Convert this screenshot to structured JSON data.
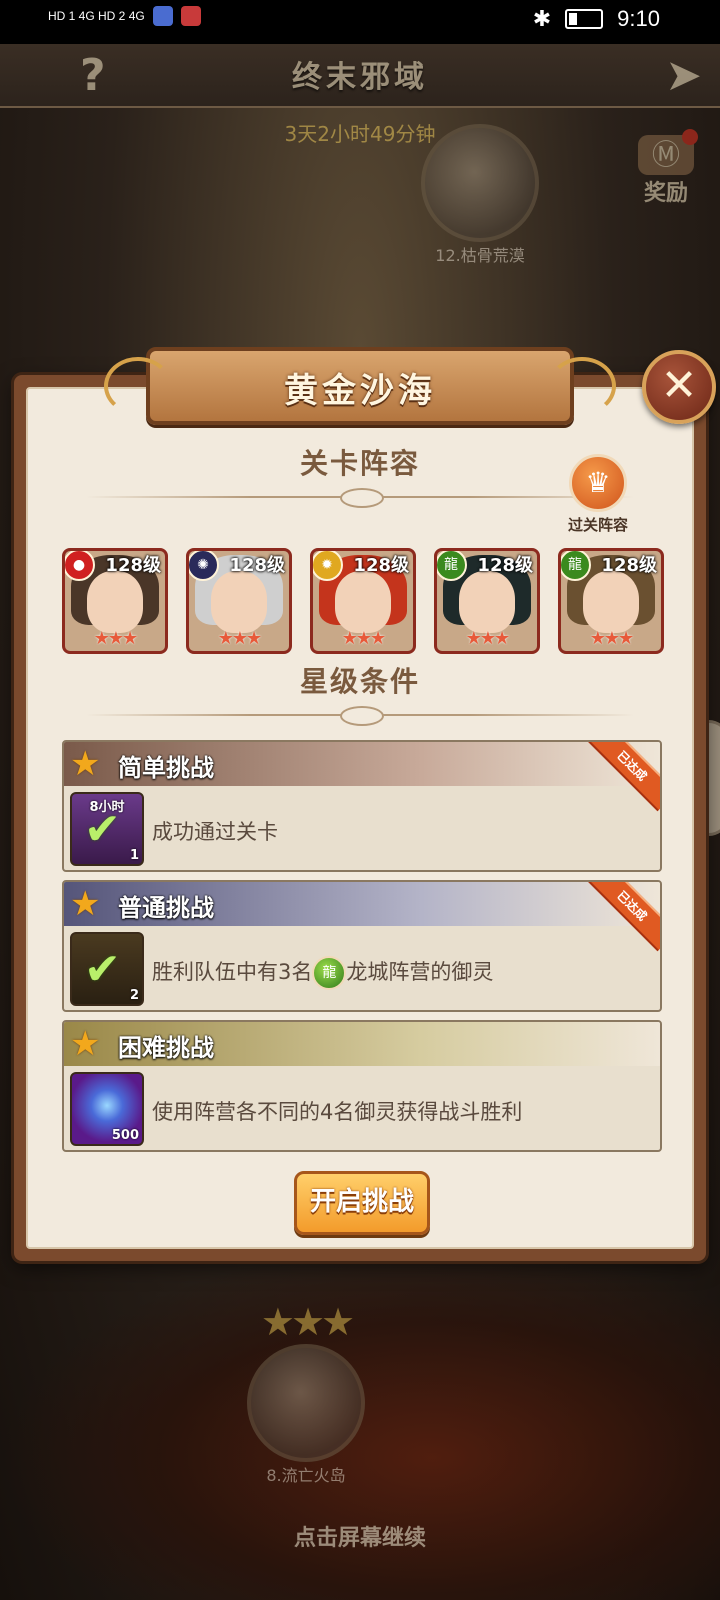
{
  "status_bar": {
    "left_text": "HD 1 4G HD 2 4G",
    "time": "9:10"
  },
  "game_header": {
    "title": "终末邪域",
    "timer": "3天2小时49分钟",
    "reward_label": "奖励",
    "help_icon": "question-mark-icon",
    "back_icon": "back-arrow-icon"
  },
  "map_nodes": [
    {
      "label": "12.枯骨荒漠"
    },
    {
      "label": "8.流亡火岛",
      "stars": "★★★"
    }
  ],
  "dialog": {
    "title": "黄金沙海",
    "lineup_title": "关卡阵容",
    "pass_lineup_label": "过关阵容",
    "star_conditions_title": "星级条件",
    "start_button": "开启挑战"
  },
  "heroes": [
    {
      "level": "128级",
      "faction": "fire",
      "faction_color": "#d02020",
      "hair_color": "#4a3628",
      "stars": "★★★"
    },
    {
      "level": "128级",
      "faction": "dark",
      "faction_color": "#2a2a5a",
      "hair_color": "#cfcfcf",
      "stars": "★★★"
    },
    {
      "level": "128级",
      "faction": "gold",
      "faction_color": "#e0a820",
      "hair_color": "#c4341c",
      "stars": "★★★"
    },
    {
      "level": "128级",
      "faction": "dragon",
      "faction_color": "#3b8a1e",
      "hair_color": "#1e2a2a",
      "stars": "★★★"
    },
    {
      "level": "128级",
      "faction": "dragon",
      "faction_color": "#3b8a1e",
      "hair_color": "#6a5030",
      "stars": "★★★"
    }
  ],
  "challenges": [
    {
      "title": "简单挑战",
      "desc": "成功通过关卡",
      "badge": "已达成",
      "item_top": "8小时",
      "item_qty": "1",
      "header_color": "#8a6a5a"
    },
    {
      "title": "普通挑战",
      "desc_before": "胜利队伍中有3名",
      "desc_after": "龙城阵营的御灵",
      "badge": "已达成",
      "item_qty": "2",
      "header_color": "#6a6a86"
    },
    {
      "title": "困难挑战",
      "desc": "使用阵营各不同的4名御灵获得战斗胜利",
      "item_qty": "500",
      "header_color": "#a08e52"
    }
  ],
  "footer": {
    "continue_text": "点击屏幕继续"
  }
}
